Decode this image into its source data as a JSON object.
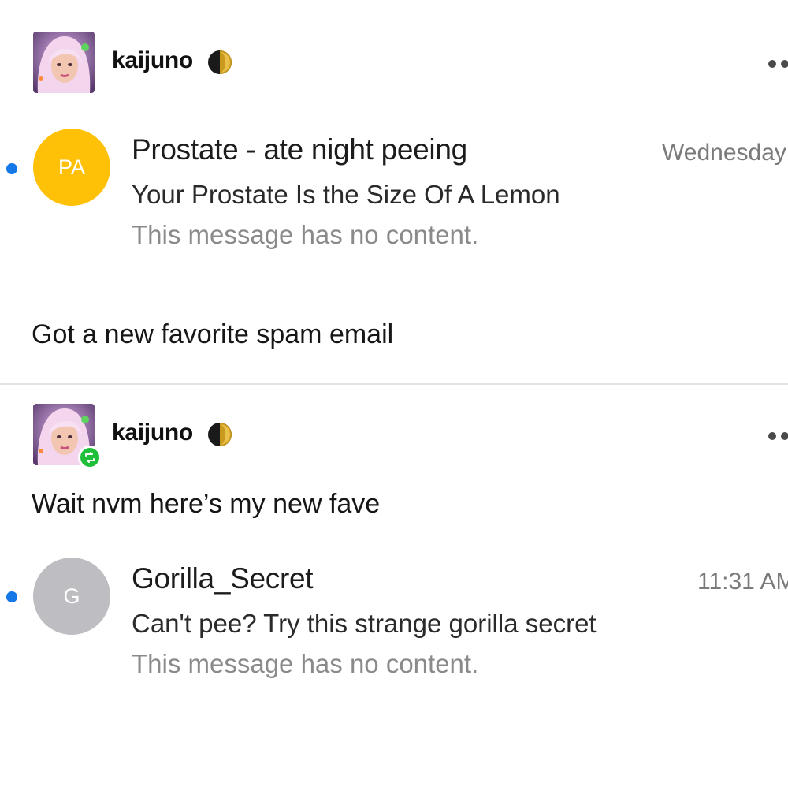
{
  "posts": [
    {
      "author": {
        "username": "kaijuno",
        "avatar_icon": "profile-avatar",
        "badge_icon": "moon-phase-icon",
        "reblogged": false
      },
      "menu_icon": "more-options-icon",
      "email": {
        "unread": true,
        "avatar_initials": "PA",
        "avatar_color": "#ffc107",
        "sender": "Prostate - ate night peeing",
        "time": "Wednesday",
        "subject": "Your Prostate Is the Size Of A Lemon",
        "preview": "This message has no content."
      },
      "caption": "Got a new favorite spam email"
    },
    {
      "author": {
        "username": "kaijuno",
        "avatar_icon": "profile-avatar",
        "badge_icon": "moon-phase-icon",
        "reblogged": true,
        "reblog_icon": "reblog-icon"
      },
      "menu_icon": "more-options-icon",
      "caption": "Wait nvm here’s my new fave",
      "email": {
        "unread": true,
        "avatar_initials": "G",
        "avatar_color": "#bdbdc2",
        "sender": "Gorilla_Secret",
        "time": "11:31 AM",
        "subject": "Can't pee? Try this strange gorilla secret",
        "preview": "This message has no content."
      }
    }
  ],
  "colors": {
    "unread_dot": "#1478e6",
    "reblog_badge": "#1fbf3a",
    "divider": "#e4e4e4"
  }
}
